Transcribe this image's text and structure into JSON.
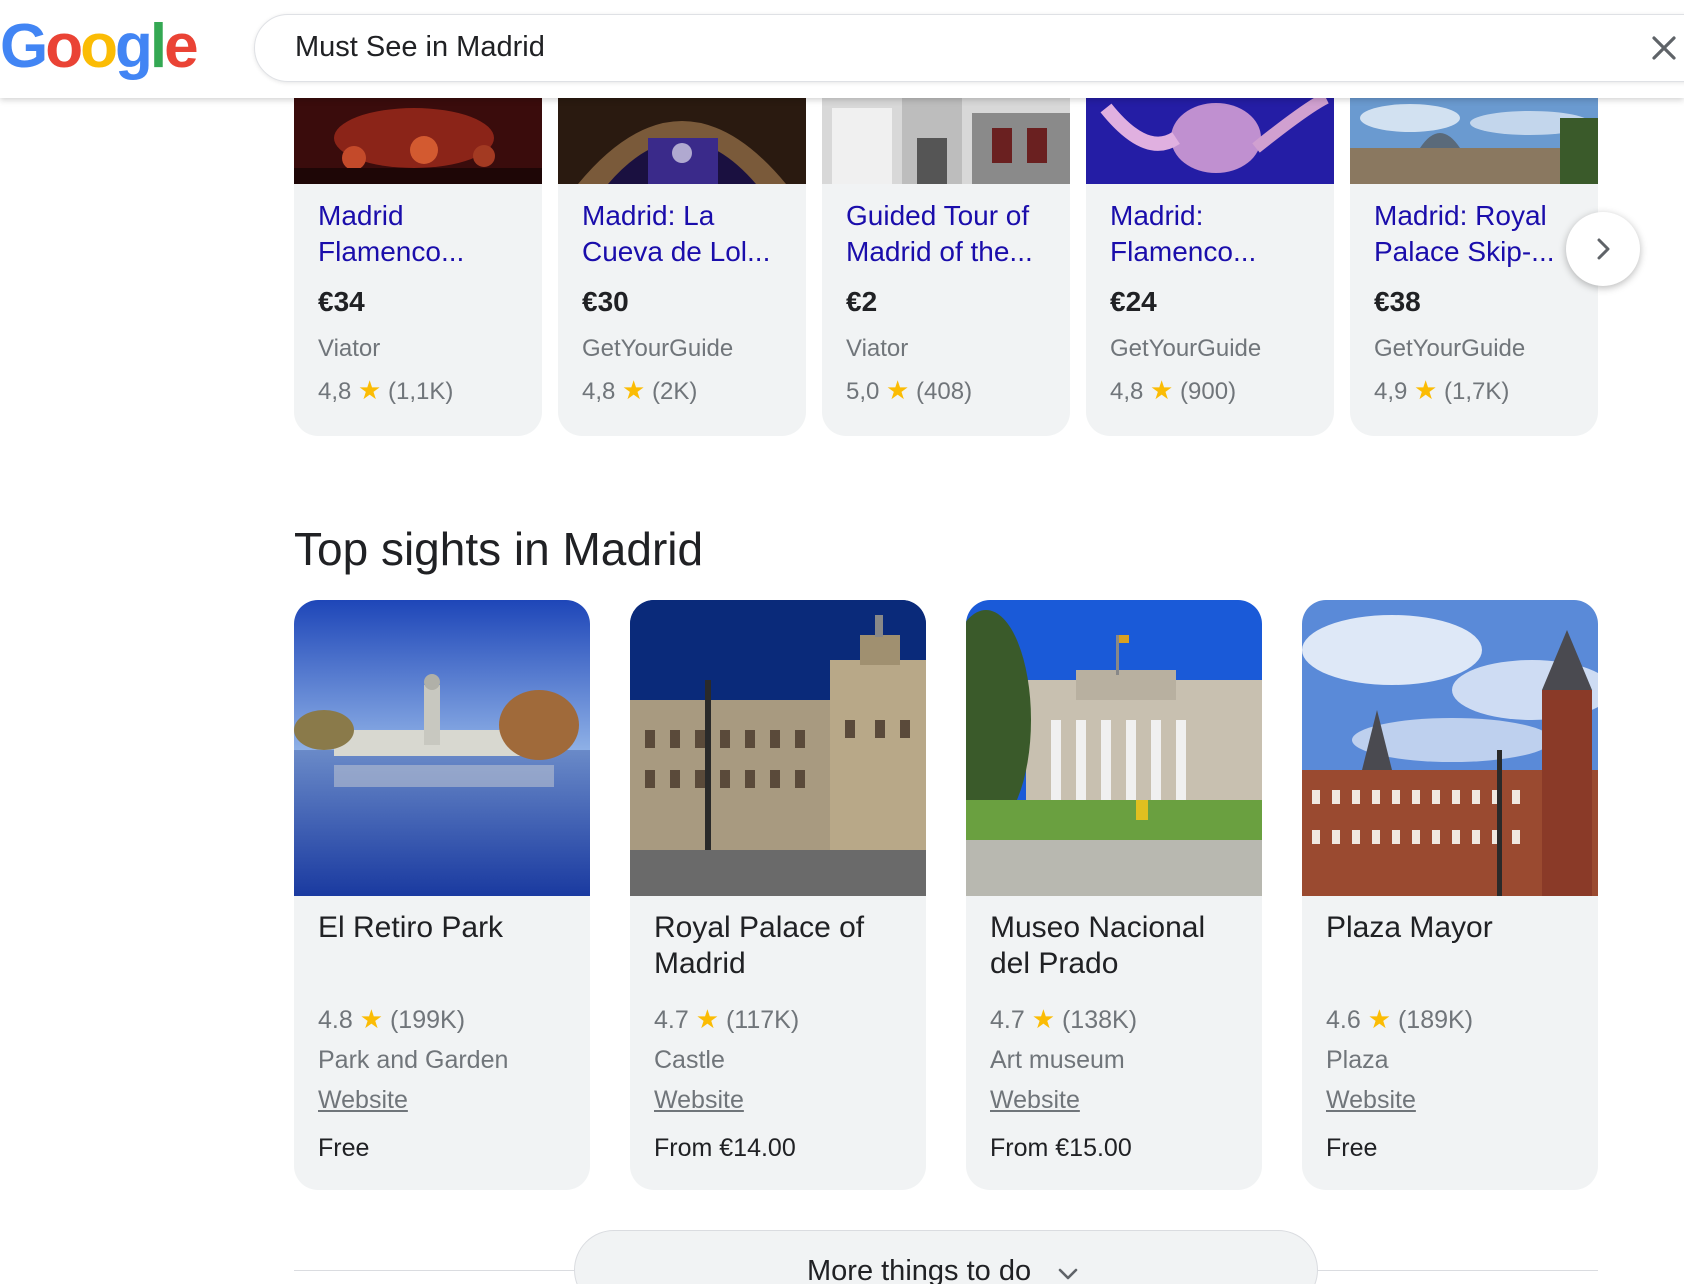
{
  "search": {
    "query": "Must See in Madrid",
    "logo": [
      "G",
      "o",
      "o",
      "g",
      "l",
      "e"
    ],
    "logo_colors": [
      "#4285F4",
      "#EA4335",
      "#FBBC05",
      "#4285F4",
      "#34A853",
      "#EA4335"
    ]
  },
  "tours": [
    {
      "title": "Madrid Flamenco...",
      "price": "€34",
      "source": "Viator",
      "rating": "4,8",
      "reviews": "(1,1K)"
    },
    {
      "title": "Madrid: La Cueva de Lol...",
      "price": "€30",
      "source": "GetYourGuide",
      "rating": "4,8",
      "reviews": "(2K)"
    },
    {
      "title": "Guided Tour of Madrid of the...",
      "price": "€2",
      "source": "Viator",
      "rating": "5,0",
      "reviews": "(408)"
    },
    {
      "title": "Madrid: Flamenco...",
      "price": "€24",
      "source": "GetYourGuide",
      "rating": "4,8",
      "reviews": "(900)"
    },
    {
      "title": "Madrid: Royal Palace Skip-...",
      "price": "€38",
      "source": "GetYourGuide",
      "rating": "4,9",
      "reviews": "(1,7K)"
    }
  ],
  "top_sights": {
    "title": "Top sights in Madrid",
    "items": [
      {
        "name": "El Retiro Park",
        "rating": "4.8",
        "reviews": "(199K)",
        "category": "Park and Garden",
        "website": "Website",
        "price": "Free"
      },
      {
        "name": "Royal Palace of Madrid",
        "rating": "4.7",
        "reviews": "(117K)",
        "category": "Castle",
        "website": "Website",
        "price": "From €14.00"
      },
      {
        "name": "Museo Nacional del Prado",
        "rating": "4.7",
        "reviews": "(138K)",
        "category": "Art museum",
        "website": "Website",
        "price": "From €15.00"
      },
      {
        "name": "Plaza Mayor",
        "rating": "4.6",
        "reviews": "(189K)",
        "category": "Plaza",
        "website": "Website",
        "price": "Free"
      }
    ]
  },
  "more_button": {
    "label": "More things to do"
  },
  "icons": {
    "clear": "close-icon",
    "next": "chevron-right-icon",
    "more": "chevron-down-icon",
    "star": "star-icon"
  },
  "colors": {
    "link": "#1a0dab",
    "star": "#fbbc04",
    "card_bg": "#f1f3f4",
    "muted": "#70757a"
  }
}
